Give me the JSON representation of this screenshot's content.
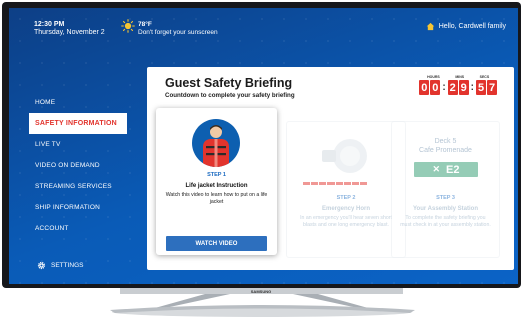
{
  "topbar": {
    "time": "12:30 PM",
    "date": "Thursday, November 2",
    "temperature": "78°F",
    "weather_note": "Don't forget your sunscreen",
    "greeting": "Hello, Cardwell family"
  },
  "sidebar": {
    "items": [
      {
        "label": "HOME",
        "active": false
      },
      {
        "label": "SAFETY INFORMATION",
        "active": true
      },
      {
        "label": "LIVE TV",
        "active": false
      },
      {
        "label": "VIDEO ON DEMAND",
        "active": false
      },
      {
        "label": "STREAMING SERVICES",
        "active": false
      },
      {
        "label": "SHIP INFORMATION",
        "active": false
      },
      {
        "label": "ACCOUNT",
        "active": false
      }
    ],
    "settings_label": "SETTINGS"
  },
  "briefing": {
    "title": "Guest Safety Briefing",
    "subtitle": "Countdown to complete your safety briefing",
    "timer": {
      "labels": [
        "HOURS",
        "MINS",
        "SECS"
      ],
      "digits": [
        "0",
        "0",
        "2",
        "9",
        "5",
        "7"
      ]
    },
    "cards": [
      {
        "step": "STEP 1",
        "title": "Life jacket Instruction",
        "description": "Watch this video to learn how to put on a life jacket",
        "button": "WATCH VIDEO"
      },
      {
        "step": "STEP 2",
        "title": "Emergency Horn",
        "description": "In an emergency you'll hear seven short blasts and one long emergency blast."
      },
      {
        "deck": "Deck 5",
        "location": "Cafe Promenade",
        "station": "E2",
        "step": "STEP 3",
        "title": "Your Assembly Station",
        "description": "To complete the safety briefing you must check in at your assembly station."
      }
    ]
  },
  "tv": {
    "brand": "SAMSUNG"
  },
  "colors": {
    "accent_red": "#e2342d",
    "screen_blue": "#0a5bb7",
    "button_blue": "#2d6fbe",
    "station_green": "#2e9b70"
  }
}
